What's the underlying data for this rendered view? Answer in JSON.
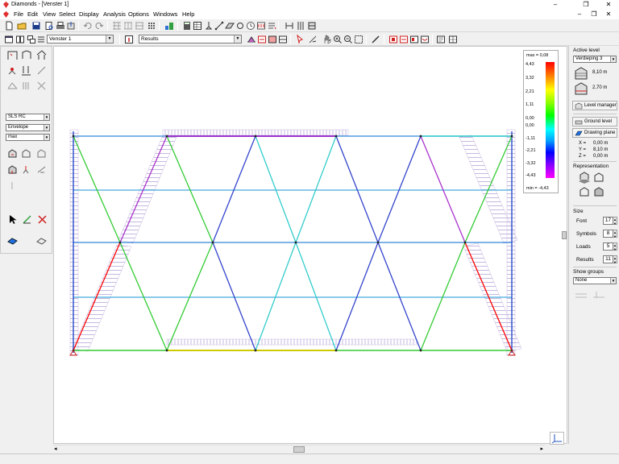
{
  "titlebar": {
    "title": "Diamonds - [Venster 1]",
    "minimize": "–",
    "restore": "❐",
    "close": "✕"
  },
  "menubar": {
    "items": [
      "File",
      "Edit",
      "View",
      "Select",
      "Display",
      "Analysis",
      "Options",
      "Windows",
      "Help"
    ],
    "win_minimize": "–",
    "win_restore": "❐",
    "win_close": "✕"
  },
  "toolbar2": {
    "window_select": "Venster 1",
    "results_select": "Results"
  },
  "leftpanel": {
    "combo1": "SLS RC",
    "combo2": "Envelope",
    "combo3": "max"
  },
  "legend": {
    "max_label": "max = 0,08",
    "min_label": "min = -4,43",
    "values": [
      "4,43",
      "3,32",
      "2,21",
      "1,11",
      "0,00",
      "0,00",
      "-1,11",
      "-2,21",
      "-3,32",
      "-4,43"
    ]
  },
  "rightpanel": {
    "active_level_heading": "Active level",
    "active_level_value": "Verdieping 3",
    "height1": "8,10 m",
    "height2": "2,70 m",
    "level_manager": "Level manager",
    "ground_level": "Ground level",
    "drawing_plane": "Drawing plane",
    "x_label": "X =",
    "x_value": "0,00 m",
    "y_label": "Y =",
    "y_value": "8,10 m",
    "z_label": "Z =",
    "z_value": "0,00 m",
    "representation_heading": "Representation",
    "size_heading": "Size",
    "font_label": "Font",
    "font_value": "17",
    "symbols_label": "Symbols",
    "symbols_value": "8",
    "loads_label": "Loads",
    "loads_value": "5",
    "results_label": "Results",
    "results_value": "11",
    "show_groups_heading": "Show groups",
    "show_groups_value": "None"
  },
  "colors": {
    "top_chord": "#9933cc",
    "bottom_chord": "#cccc00",
    "red_member": "#ff0000",
    "green_member": "#33cc33",
    "cyan_member": "#33cccc",
    "blue_member": "#3333cc",
    "column": "#3355cc",
    "hatch": "#b0a0d0"
  }
}
